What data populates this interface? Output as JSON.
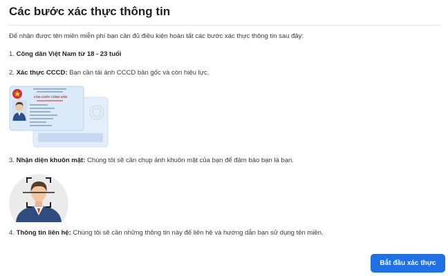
{
  "title": "Các bước xác thực thông tin",
  "intro": "Để nhận được tên miền miễn phí bạn cần đủ điều kiện hoàn tất các bước xác thực thông tin sau đây:",
  "steps": [
    {
      "number": "1.",
      "label": "Công dân Việt Nam từ 18 - 23 tuổi",
      "desc": ""
    },
    {
      "number": "2.",
      "label": "Xác thực CCCD:",
      "desc": "Bạn cần tải ảnh CCCD bản gốc và còn hiệu lực."
    },
    {
      "number": "3.",
      "label": "Nhận diện khuôn mặt:",
      "desc": "Chúng tôi sẽ cần chụp ảnh khuôn mặt của bạn để đảm bảo bạn là bạn."
    },
    {
      "number": "4.",
      "label": "Thông tin liên hệ:",
      "desc": "Chúng tôi sẽ cần những thông tin này để liên hệ và hướng dẫn bạn sử dụng tên miền."
    }
  ],
  "card": {
    "header": "CĂN CƯỚC CÔNG DÂN"
  },
  "button": {
    "label": "Bắt đầu xác thực"
  },
  "colors": {
    "primary": "#1f6fe5",
    "card_bg": "#dcebf9",
    "face_bg": "#ebebeb"
  }
}
